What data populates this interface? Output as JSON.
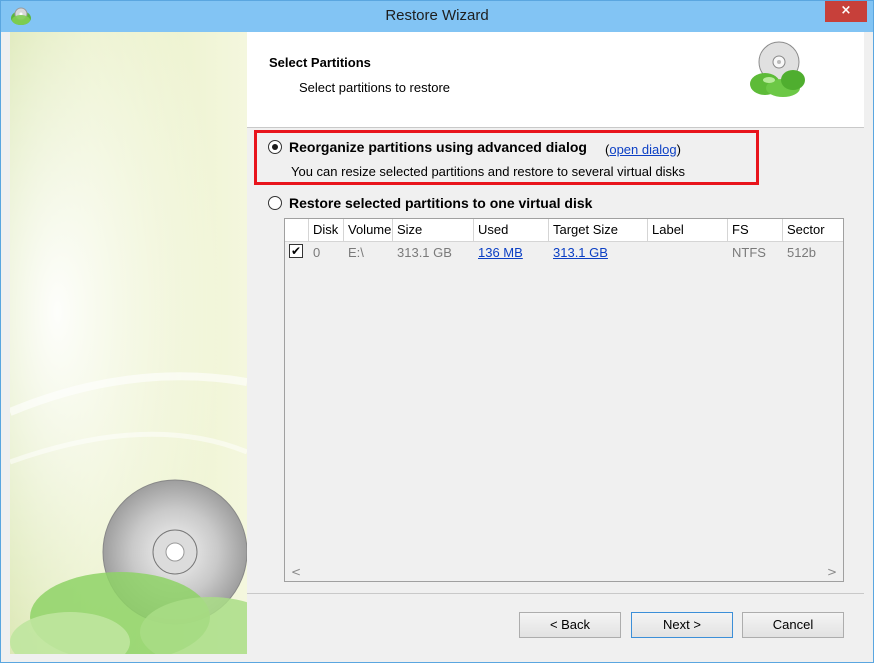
{
  "window": {
    "title": "Restore Wizard",
    "close_glyph": "×"
  },
  "header": {
    "title": "Select Partitions",
    "subtitle": "Select partitions to restore"
  },
  "options": {
    "advanced": {
      "label": "Reorganize partitions using advanced dialog",
      "paren_open": "(",
      "link": "open dialog",
      "paren_close": ")",
      "description": "You can resize selected partitions and restore to several virtual disks",
      "selected": true
    },
    "single": {
      "label": "Restore selected partitions to one virtual disk",
      "selected": false
    }
  },
  "table": {
    "columns": [
      "Disk",
      "Volume",
      "Size",
      "Used",
      "Target Size",
      "Label",
      "FS",
      "Sector"
    ],
    "rows": [
      {
        "checked": true,
        "check_glyph": "✔",
        "disk": "0",
        "volume": "E:\\",
        "size": "313.1 GB",
        "used": "136 MB",
        "target_size": "313.1 GB",
        "label": "",
        "fs": "NTFS",
        "sector": "512b"
      }
    ],
    "scroll_left_glyph": "<",
    "scroll_right_glyph": ">"
  },
  "buttons": {
    "back": "< Back",
    "next": "Next >",
    "cancel": "Cancel"
  },
  "colors": {
    "highlight": "#e8141c",
    "link": "#0b3fc4",
    "titlebar": "#82c4f4"
  },
  "icons": [
    "app-icon",
    "close-icon",
    "disc-logo-icon",
    "checkbox-check-icon"
  ]
}
